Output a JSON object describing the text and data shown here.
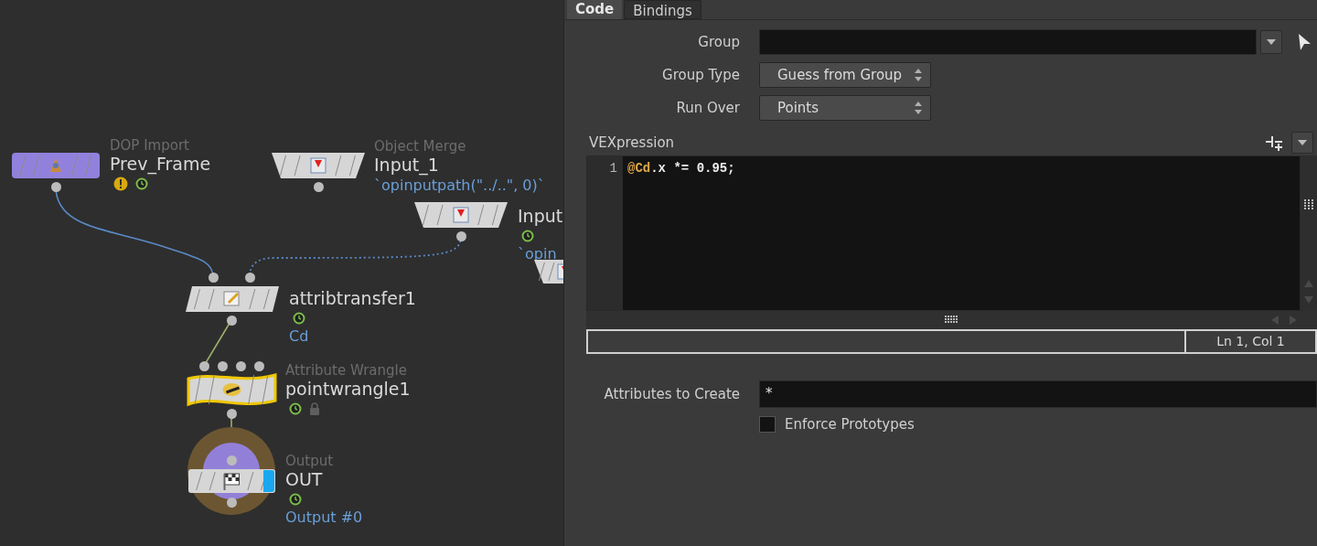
{
  "network": {
    "nodes": [
      {
        "kind": "dop_import",
        "type_label": "DOP Import",
        "name": "Prev_Frame",
        "warning": true,
        "time_dependent": true,
        "locked": false,
        "selected": false,
        "display": false
      },
      {
        "kind": "object_merge",
        "type_label": "Object Merge",
        "name": "Input_1",
        "note": "`opinputpath(\"../..\", 0)`",
        "warning": false,
        "time_dependent": false,
        "locked": false,
        "selected": false,
        "display": false
      },
      {
        "kind": "object_merge",
        "name": "Input",
        "note": "`opin",
        "warning": false,
        "time_dependent": true,
        "locked": false,
        "selected": false,
        "display": false
      },
      {
        "kind": "object_merge",
        "warning": false,
        "time_dependent": false,
        "locked": false,
        "selected": false,
        "display": false
      },
      {
        "kind": "attribtransfer",
        "name": "attribtransfer1",
        "note": "Cd",
        "warning": false,
        "time_dependent": true,
        "locked": false,
        "selected": false,
        "display": false
      },
      {
        "kind": "wrangle",
        "type_label": "Attribute Wrangle",
        "name": "pointwrangle1",
        "warning": false,
        "time_dependent": true,
        "locked": true,
        "selected": true,
        "display": false
      },
      {
        "kind": "output",
        "type_label": "Output",
        "name": "OUT",
        "note": "Output #0",
        "warning": false,
        "time_dependent": true,
        "locked": false,
        "selected": false,
        "display": true
      }
    ]
  },
  "parameters": {
    "tabs": [
      {
        "label": "Code",
        "selected": true
      },
      {
        "label": "Bindings",
        "selected": false
      }
    ],
    "group": {
      "label": "Group"
    },
    "group_type": {
      "label": "Group Type",
      "value": "Guess from Group"
    },
    "run_over": {
      "label": "Run Over",
      "value": "Points"
    },
    "vexpression": {
      "label": "VEXpression",
      "lines": [
        {
          "number": "1",
          "tokens": [
            {
              "kind": "attribute",
              "text": "@Cd"
            },
            {
              "kind": "plain",
              "text": ".x *= 0.95;"
            }
          ]
        }
      ]
    },
    "status": "Ln 1, Col 1",
    "attributes_to_create": {
      "label": "Attributes to Create",
      "value": "*"
    },
    "enforce_prototypes": {
      "label": "Enforce Prototypes",
      "checked": false
    }
  }
}
